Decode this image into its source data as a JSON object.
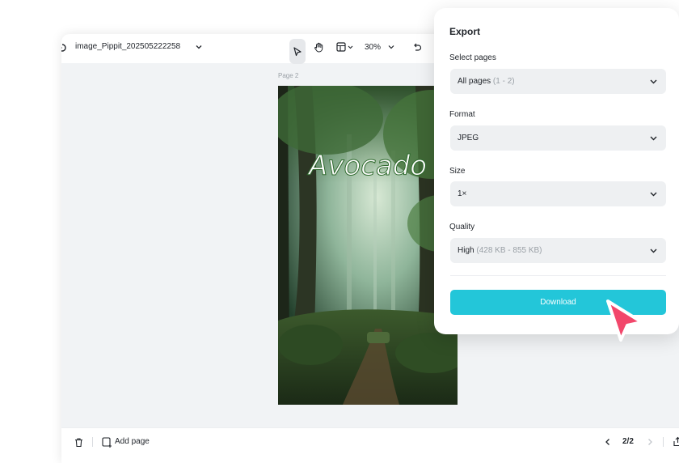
{
  "editor": {
    "doc_title": "image_Pippit_202505222258",
    "zoom": "30%",
    "page_label": "Page 2",
    "canvas_text": "Avocado"
  },
  "bottombar": {
    "add_page_label": "Add page",
    "page_counter": "2/2"
  },
  "export_panel": {
    "title": "Export",
    "select_pages": {
      "label": "Select pages",
      "value": "All pages",
      "hint": "(1 - 2)"
    },
    "format": {
      "label": "Format",
      "value": "JPEG"
    },
    "size": {
      "label": "Size",
      "value": "1×"
    },
    "quality": {
      "label": "Quality",
      "value": "High",
      "hint": "(428 KB - 855 KB)"
    },
    "download_label": "Download"
  },
  "colors": {
    "accent": "#23c6d9",
    "cursor": "#f2476b",
    "canvas_bg": "#f1f3f5"
  },
  "icons": [
    "back-icon",
    "chevron-down-icon",
    "pointer-tool-icon",
    "hand-tool-icon",
    "layout-icon",
    "undo-icon",
    "trash-icon",
    "add-page-icon",
    "chevron-left-icon",
    "chevron-right-icon",
    "share-icon",
    "cursor-arrow-icon"
  ]
}
